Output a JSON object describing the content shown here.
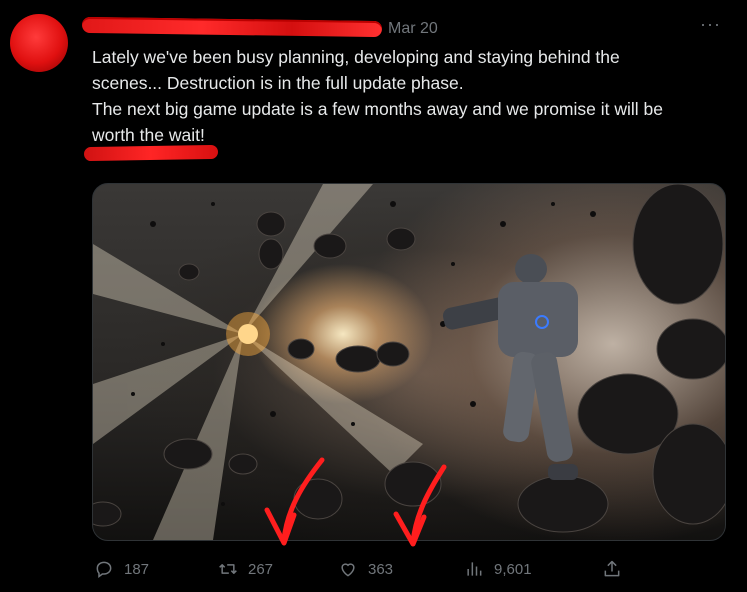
{
  "tweet": {
    "date": "Mar 20",
    "more_label": "···",
    "text_lines": [
      "Lately we've been busy planning, developing and staying behind the",
      "scenes... Destruction is in the full update phase.",
      "The next big game update is a few months away and we promise it will be",
      "worth the wait!"
    ]
  },
  "actions": {
    "replies": "187",
    "retweets": "267",
    "likes": "363",
    "views": "9,601"
  },
  "colors": {
    "background": "#000000",
    "text": "#e7e9ea",
    "muted": "#71767b",
    "annotation_red": "#ff2020"
  },
  "icons": [
    "reply-icon",
    "retweet-icon",
    "like-icon",
    "views-icon",
    "share-icon",
    "more-icon"
  ]
}
